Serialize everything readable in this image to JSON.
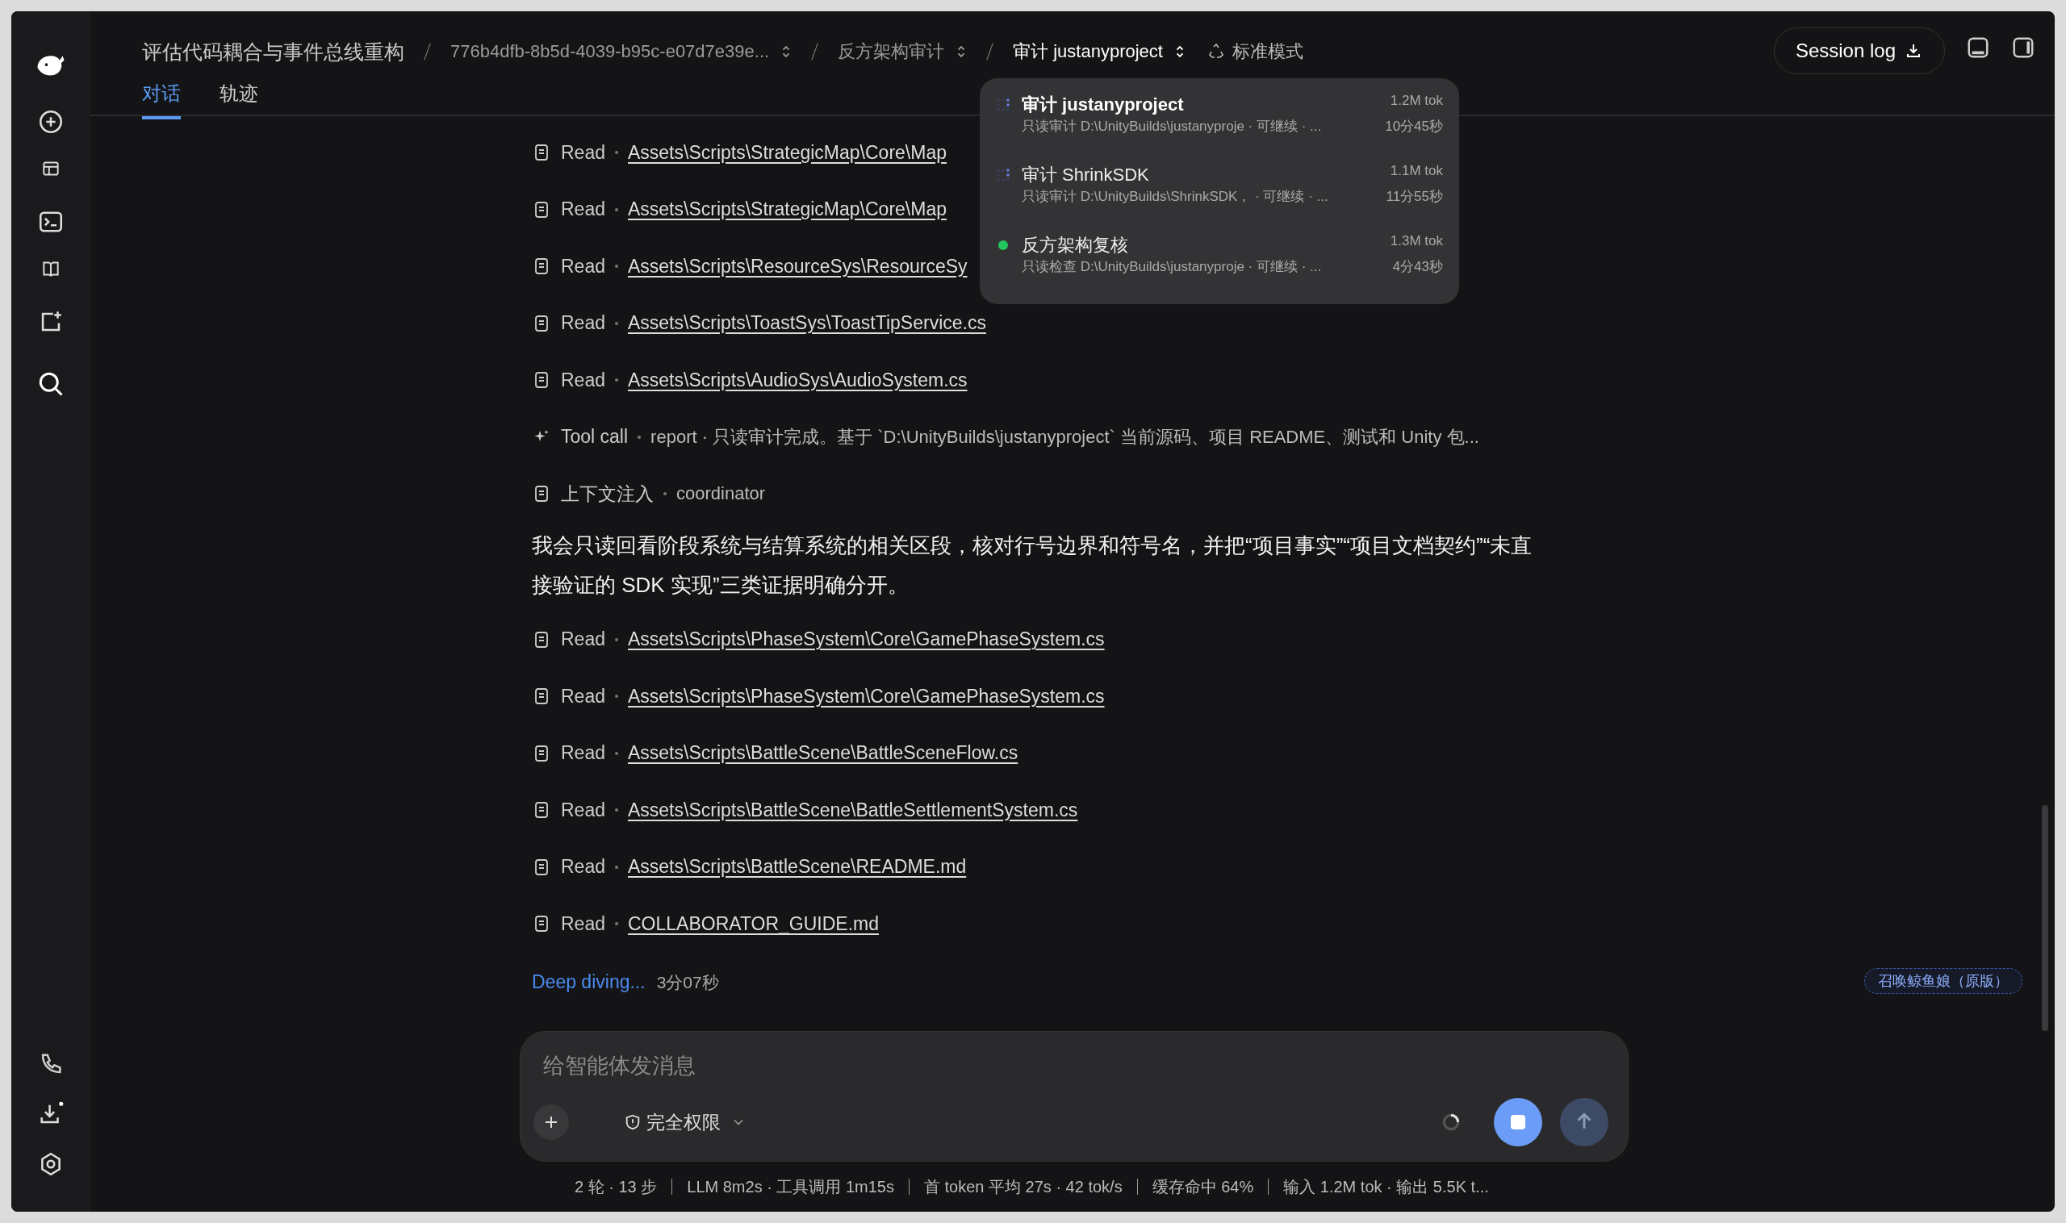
{
  "breadcrumb": [
    {
      "kind": "title",
      "text": "评估代码耦合与事件总线重构"
    },
    {
      "kind": "switcher",
      "text": "776b4dfb-8b5d-4039-b95c-e07d7e39e...",
      "selected": false
    },
    {
      "kind": "switcher",
      "text": "反方架构审计",
      "selected": false
    },
    {
      "kind": "switcher",
      "text": "审计 justanyproject",
      "selected": true
    },
    {
      "kind": "mode",
      "text": "标准模式"
    }
  ],
  "tabs": [
    {
      "label": "对话",
      "selected": true
    },
    {
      "label": "轨迹",
      "selected": false
    }
  ],
  "session_log_button": "Session log",
  "session_menu": [
    {
      "kind": "running",
      "title": "审计 justanyproject",
      "tokens": "1.2M tok",
      "subtitle": "只读审计 D:\\UnityBuilds\\justanyproje · 可继续 · ...",
      "duration": "10分45秒",
      "selected": true
    },
    {
      "kind": "running",
      "title": "审计 ShrinkSDK",
      "tokens": "1.1M tok",
      "subtitle": "只读审计 D:\\UnityBuilds\\ShrinkSDK， · 可继续 · ...",
      "duration": "11分55秒",
      "selected": false
    },
    {
      "kind": "done",
      "title": "反方架构复核",
      "tokens": "1.3M tok",
      "subtitle": "只读检查 D:\\UnityBuilds\\justanyproje · 可继续 · ...",
      "duration": "4分43秒",
      "selected": false
    }
  ],
  "activity": [
    {
      "kind": "read",
      "label": "Read",
      "path": "Assets\\Scripts\\StrategicMap\\Core\\Map"
    },
    {
      "kind": "read",
      "label": "Read",
      "path": "Assets\\Scripts\\StrategicMap\\Core\\Map"
    },
    {
      "kind": "read",
      "label": "Read",
      "path": "Assets\\Scripts\\ResourceSys\\ResourceSy"
    },
    {
      "kind": "read",
      "label": "Read",
      "path": "Assets\\Scripts\\ToastSys\\ToastTipService.cs"
    },
    {
      "kind": "read",
      "label": "Read",
      "path": "Assets\\Scripts\\AudioSys\\AudioSystem.cs"
    },
    {
      "kind": "tool_call",
      "label": "Tool call",
      "detail": "report · 只读审计完成。基于 `D:\\UnityBuilds\\justanyproject` 当前源码、项目 README、测试和 Unity 包..."
    },
    {
      "kind": "context",
      "label": "上下文注入",
      "detail": "coordinator"
    },
    {
      "kind": "message",
      "text": "我会只读回看阶段系统与结算系统的相关区段，核对行号边界和符号名，并把“项目事实”“项目文档契约”“未直接验证的 SDK 实现”三类证据明确分开。"
    },
    {
      "kind": "read",
      "label": "Read",
      "path": "Assets\\Scripts\\PhaseSystem\\Core\\GamePhaseSystem.cs"
    },
    {
      "kind": "read",
      "label": "Read",
      "path": "Assets\\Scripts\\PhaseSystem\\Core\\GamePhaseSystem.cs"
    },
    {
      "kind": "read",
      "label": "Read",
      "path": "Assets\\Scripts\\BattleScene\\BattleSceneFlow.cs"
    },
    {
      "kind": "read",
      "label": "Read",
      "path": "Assets\\Scripts\\BattleScene\\BattleSettlementSystem.cs"
    },
    {
      "kind": "read",
      "label": "Read",
      "path": "Assets\\Scripts\\BattleScene\\README.md"
    },
    {
      "kind": "read",
      "label": "Read",
      "path": "COLLABORATOR_GUIDE.md"
    }
  ],
  "progress": {
    "label": "Deep diving...",
    "duration": "3分07秒"
  },
  "summon_badge": "召唤鲸鱼娘（原版）",
  "composer": {
    "placeholder": "给智能体发消息",
    "permission": "完全权限"
  },
  "status_bar": [
    "2 轮 · 13 步",
    "LLM 8m2s · 工具调用 1m15s",
    "首 token 平均 27s · 42 tok/s",
    "缓存命中 64%",
    "输入 1.2M tok · 输出 5.5K t..."
  ]
}
